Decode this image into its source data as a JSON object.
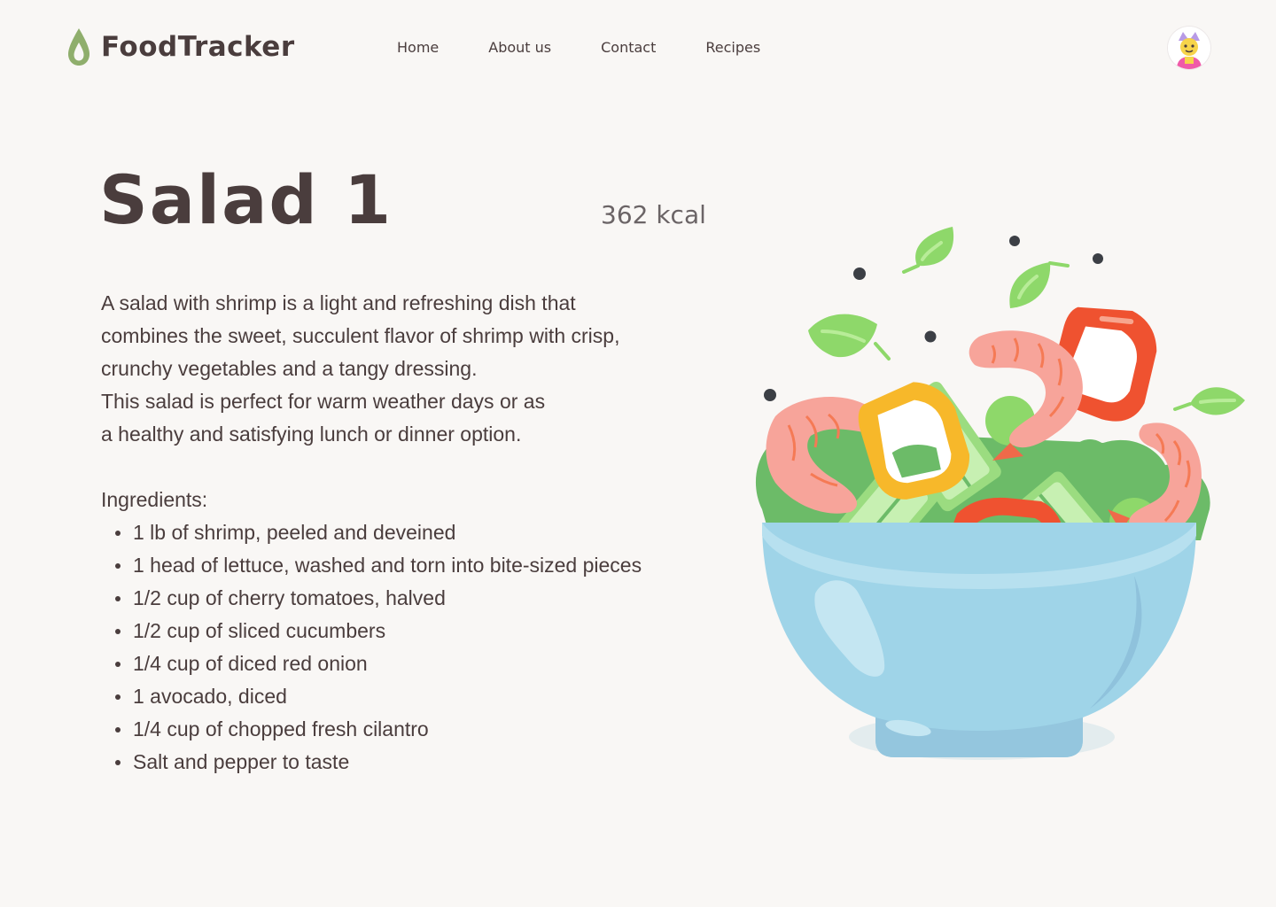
{
  "header": {
    "logo_text": "FoodTracker",
    "logo_icon": "drop-icon",
    "nav": [
      {
        "label": "Home"
      },
      {
        "label": "About us"
      },
      {
        "label": "Contact"
      },
      {
        "label": "Recipes"
      }
    ],
    "avatar_icon": "user-avatar-icon"
  },
  "recipe": {
    "title": "Salad 1",
    "calories": "362 kcal",
    "description": [
      "A salad with shrimp is a light and refreshing dish that",
      "combines the sweet, succulent flavor of shrimp with crisp,",
      "crunchy vegetables and a tangy dressing.",
      "This salad is perfect for warm weather days or as",
      "a healthy and satisfying lunch or dinner option."
    ],
    "ingredients_heading": "Ingredients:",
    "ingredients": [
      "1 lb of shrimp, peeled and deveined",
      "1 head of lettuce, washed and torn into bite-sized pieces",
      "1/2 cup of cherry tomatoes, halved",
      "1/2 cup of sliced cucumbers",
      "1/4 cup of diced red onion",
      "1 avocado, diced",
      "1/4 cup of chopped fresh cilantro",
      "Salt and pepper to taste"
    ]
  },
  "colors": {
    "background": "#f9f7f5",
    "text": "#4a3d3d",
    "muted_text": "#6b6466",
    "logo_green": "#8fae6c",
    "bowl_blue": "#9fd4e8"
  }
}
